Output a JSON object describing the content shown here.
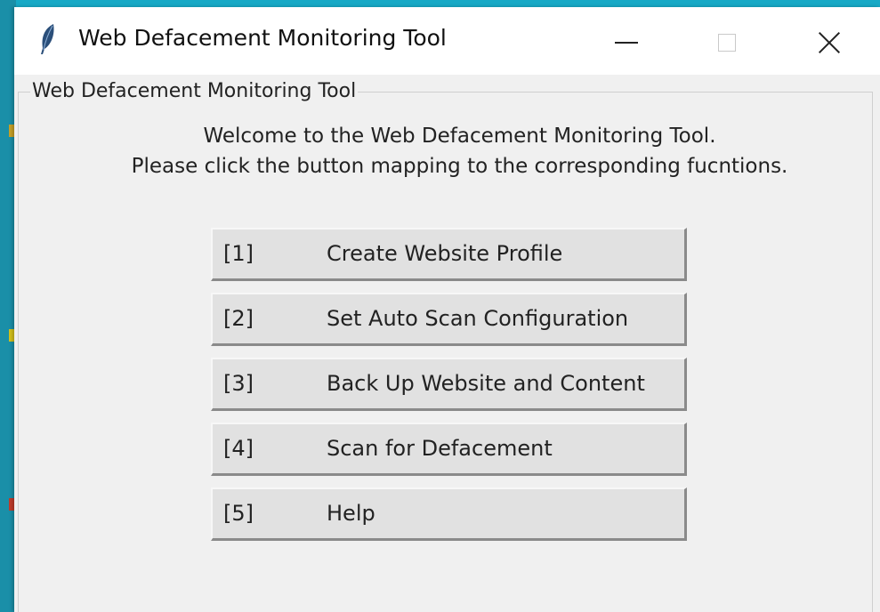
{
  "window": {
    "title": "Web Defacement Monitoring Tool",
    "icon": "feather-icon"
  },
  "group": {
    "label": "Web Defacement Monitoring Tool"
  },
  "welcome": {
    "line1": "Welcome to the Web Defacement Monitoring Tool.",
    "line2": "Please click the button mapping to the corresponding fucntions."
  },
  "buttons": [
    {
      "num": "[1]",
      "label": "Create Website Profile"
    },
    {
      "num": "[2]",
      "label": "Set Auto Scan Configuration"
    },
    {
      "num": "[3]",
      "label": "Back Up Website and Content"
    },
    {
      "num": "[4]",
      "label": "Scan for Defacement"
    },
    {
      "num": "[5]",
      "label": "Help"
    }
  ],
  "colors": {
    "desktop_bg": "#17a9c6",
    "window_bg": "#f0f0f0",
    "button_bg": "#e1e1e1"
  }
}
